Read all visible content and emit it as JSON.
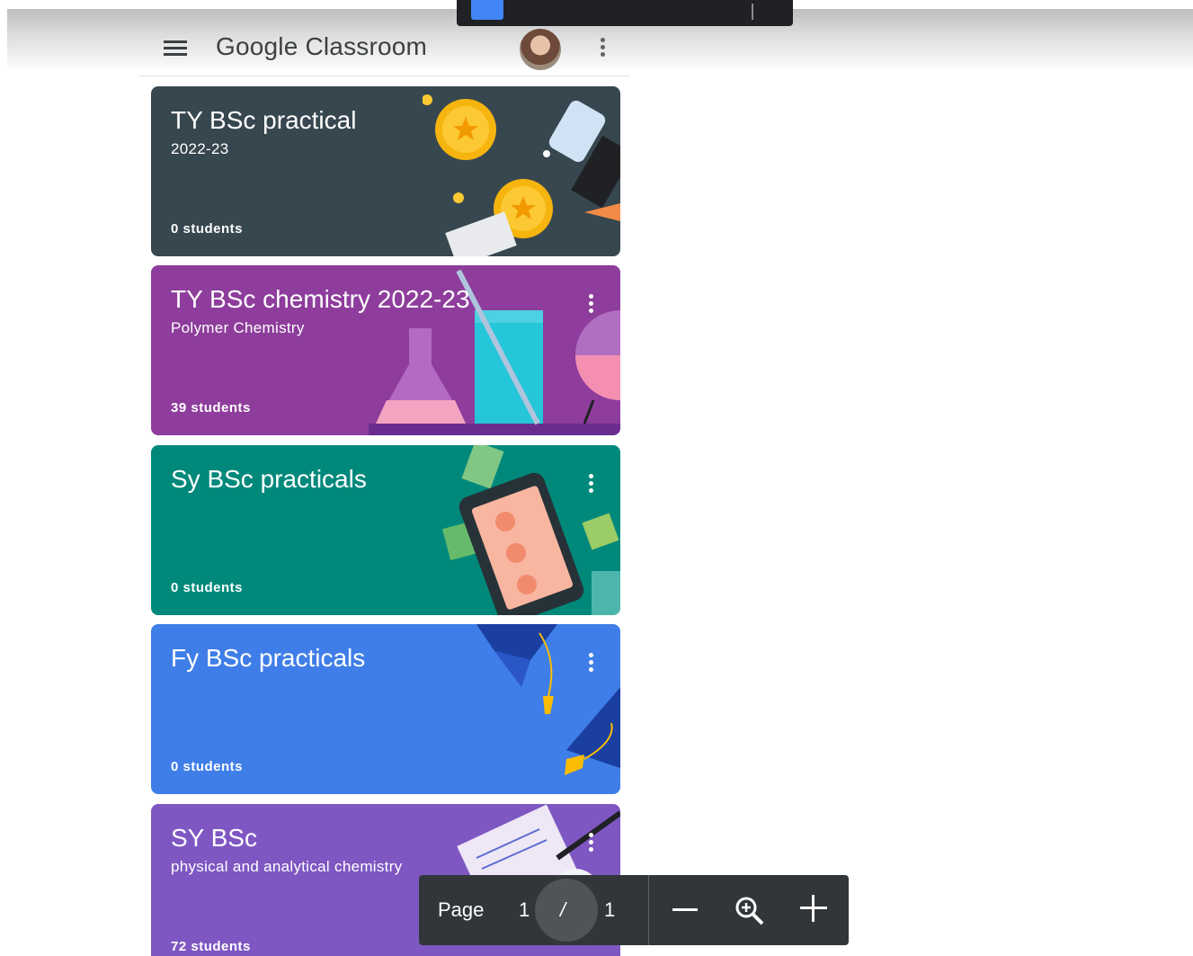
{
  "app": {
    "title": "Google Classroom",
    "menu_icon": "hamburger-menu-icon",
    "account_icon": "avatar",
    "more_icon": "more-vert-icon"
  },
  "courses": [
    {
      "title": "TY BSc practical",
      "subtitle": "2022-23",
      "students": "0 students",
      "color": "#37474f",
      "theme": "coins-telescope"
    },
    {
      "title": "TY BSc chemistry 2022-23",
      "subtitle": "Polymer Chemistry",
      "students": "39 students",
      "color": "#8e3d9c",
      "theme": "chemistry-flasks"
    },
    {
      "title": "Sy BSc practicals",
      "subtitle": "",
      "students": "0 students",
      "color": "#00897b",
      "theme": "phone"
    },
    {
      "title": "Fy BSc practicals",
      "subtitle": "",
      "students": "0 students",
      "color": "#3f7ee8",
      "theme": "graduation-caps"
    },
    {
      "title": "SY BSc",
      "subtitle": "physical and analytical chemistry",
      "students": "72 students",
      "color": "#7e57c2",
      "theme": "document-pen"
    }
  ],
  "pdf_toolbar": {
    "page_label": "Page",
    "current_page": "1",
    "separator": "/",
    "total_pages": "1",
    "zoom_out_icon": "minus-icon",
    "fit_icon": "zoom-magnifier-icon",
    "zoom_in_icon": "plus-icon"
  }
}
